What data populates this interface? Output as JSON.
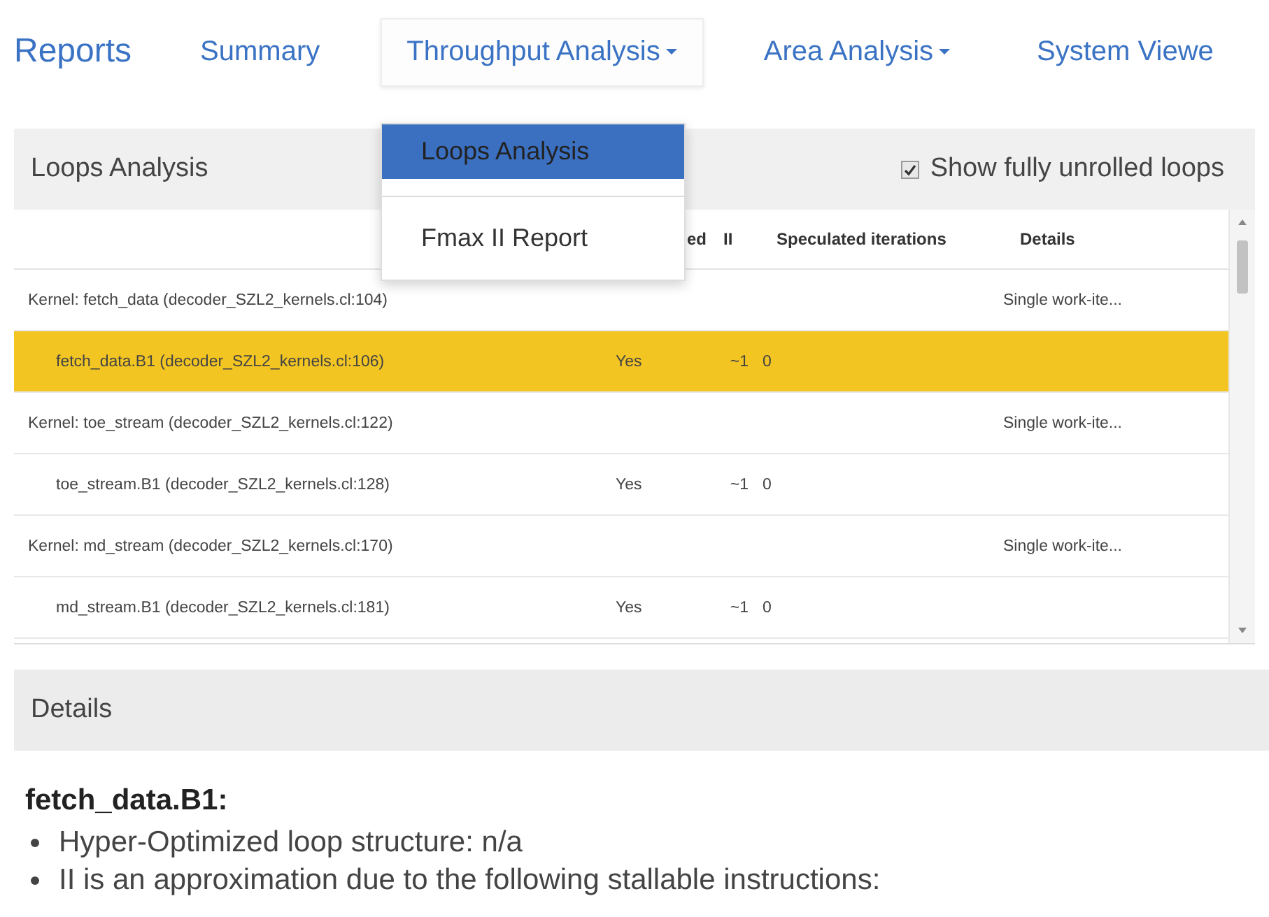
{
  "navbar": {
    "brand": "Reports",
    "items": [
      {
        "label": "Summary",
        "has_menu": false,
        "expanded": false
      },
      {
        "label": "Throughput Analysis",
        "has_menu": true,
        "expanded": true
      },
      {
        "label": "Area Analysis",
        "has_menu": true,
        "expanded": false
      },
      {
        "label": "System Viewe",
        "has_menu": false,
        "expanded": false
      }
    ]
  },
  "dropdown": {
    "items": [
      {
        "label": "Loops Analysis",
        "selected": true
      },
      {
        "label": "Fmax II Report",
        "selected": false
      }
    ]
  },
  "loops_panel": {
    "title": "Loops Analysis",
    "show_unrolled": {
      "label": "Show fully unrolled loops",
      "checked": true
    },
    "table": {
      "columns": [
        "ed",
        "II",
        "Speculated iterations",
        "Details"
      ],
      "rows": [
        {
          "kind": "kernel",
          "name": "Kernel: fetch_data (decoder_SZL2_kernels.cl:104)",
          "details": "Single work-ite...",
          "selected": false
        },
        {
          "kind": "block",
          "name": "fetch_data.B1 (decoder_SZL2_kernels.cl:106)",
          "pipelined": "Yes",
          "ii": "~1",
          "speculated": "0",
          "selected": true
        },
        {
          "kind": "kernel",
          "name": "Kernel: toe_stream (decoder_SZL2_kernels.cl:122)",
          "details": "Single work-ite...",
          "selected": false
        },
        {
          "kind": "block",
          "name": "toe_stream.B1 (decoder_SZL2_kernels.cl:128)",
          "pipelined": "Yes",
          "ii": "~1",
          "speculated": "0",
          "selected": false
        },
        {
          "kind": "kernel",
          "name": "Kernel: md_stream (decoder_SZL2_kernels.cl:170)",
          "details": "Single work-ite...",
          "selected": false
        },
        {
          "kind": "block",
          "name": "md_stream.B1 (decoder_SZL2_kernels.cl:181)",
          "pipelined": "Yes",
          "ii": "~1",
          "speculated": "0",
          "selected": false
        }
      ]
    }
  },
  "details_panel": {
    "title": "Details",
    "heading": "fetch_data.B1:",
    "bullets": [
      "Hyper-Optimized loop structure: n/a",
      "II is an approximation due to the following stallable instructions:"
    ]
  }
}
